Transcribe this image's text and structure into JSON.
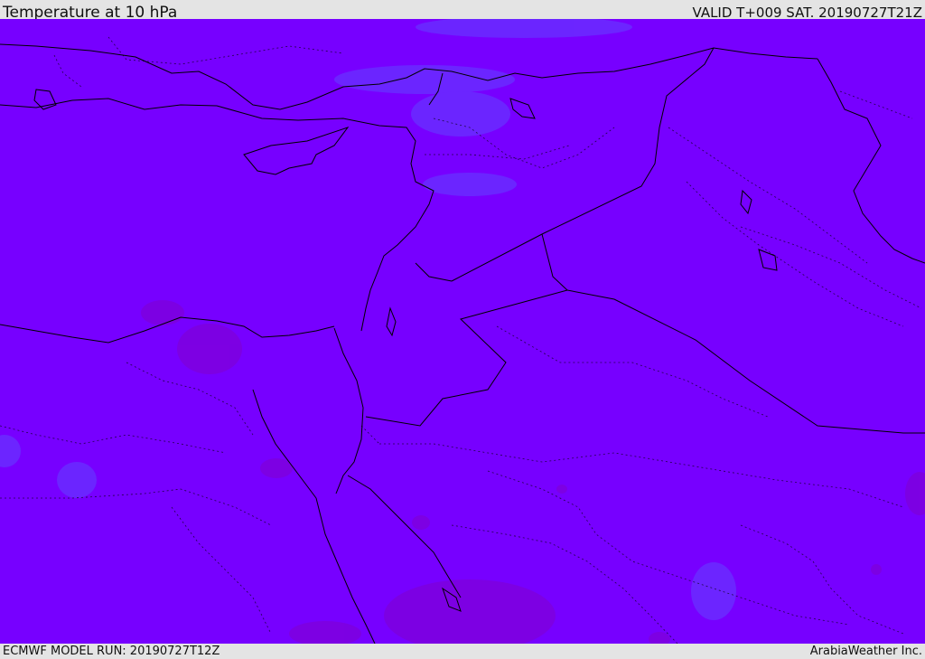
{
  "header": {
    "title": "Temperature at 10 hPa",
    "valid_time": "VALID T+009 SAT. 20190727T21Z"
  },
  "footer": {
    "model_run": "ECMWF MODEL RUN: 20190727T12Z",
    "credit": "ArabiaWeather Inc."
  },
  "map": {
    "field_color": "#7700ff",
    "cool_patch_color": "#6a2cff",
    "warm_patch_color": "#7d00e0",
    "coastline_color": "#000000",
    "border_style": "dotted"
  }
}
